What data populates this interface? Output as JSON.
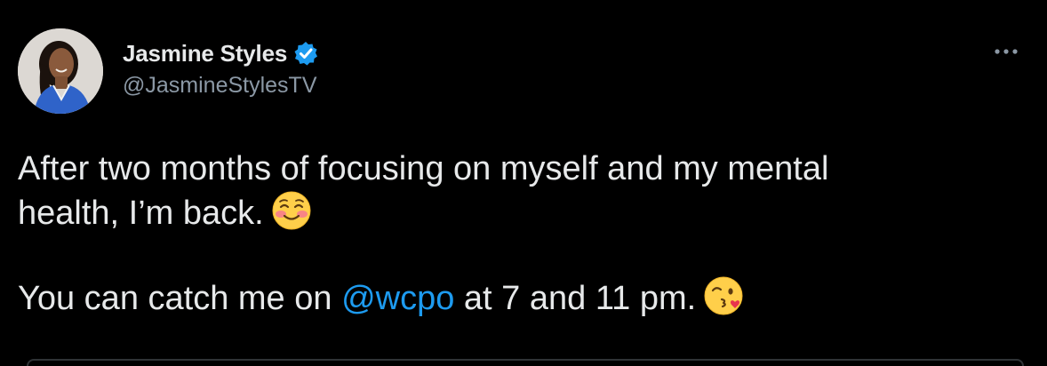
{
  "author": {
    "display_name": "Jasmine Styles",
    "handle": "@JasmineStylesTV",
    "verified": true,
    "avatar_icon": "avatar-photo"
  },
  "menu": {
    "icon": "more-options-icon"
  },
  "tweet": {
    "line1": "After two months of focusing on myself and my mental",
    "line2_text": "health, I’m back.",
    "line2_emoji": "smiling-face-with-blush-emoji",
    "line3_prefix": "You can catch me on ",
    "line3_mention": "@wcpo",
    "line3_suffix": " at 7 and 11 pm.",
    "line3_emoji": "face-blowing-kiss-emoji"
  },
  "colors": {
    "background": "#000000",
    "text": "#e7e9ea",
    "secondary": "#8b98a5",
    "accent": "#1d9bf0"
  }
}
